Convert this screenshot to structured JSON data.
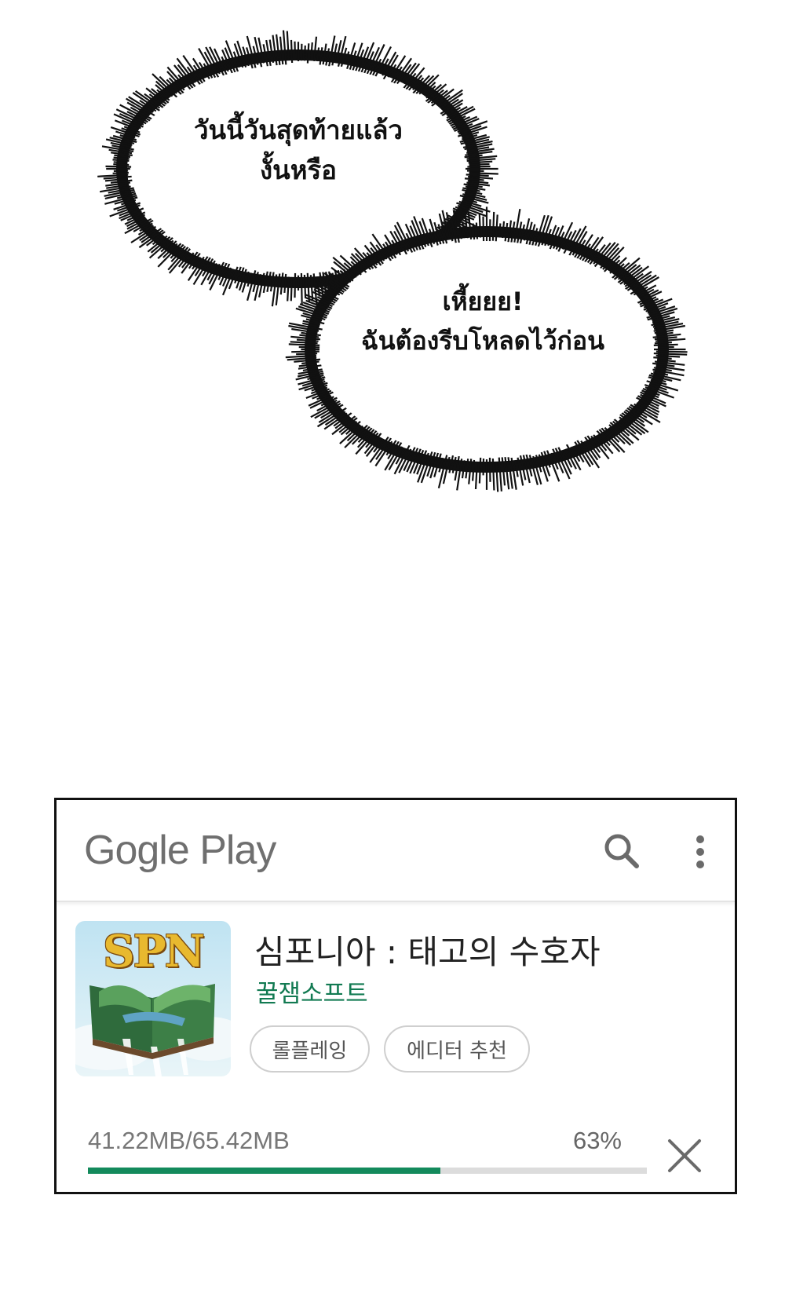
{
  "comic": {
    "bubble_1": {
      "line_1": "วันนี้วันสุดท้ายแล้ว",
      "line_2": "งั้นหรือ"
    },
    "bubble_2": {
      "line_1": "เหี้ยยย!",
      "line_2": "ฉันต้องรีบโหลดไว้ก่อน"
    }
  },
  "store": {
    "logo_text": "Gogle Play",
    "search_icon": "search-icon",
    "more_icon": "more-vert-icon",
    "app": {
      "icon_text": "SPN",
      "title": "심포니아 : 태고의 수호자",
      "developer": "꿀잼소프트",
      "tags": [
        "롤플레잉",
        "에디터 추천"
      ]
    },
    "download": {
      "size_text": "41.22MB/65.42MB",
      "percent_text": "63%",
      "progress": 0.63,
      "cancel_icon": "close-icon"
    },
    "colors": {
      "accent": "#138a5c",
      "developer": "#127a52",
      "track": "#dcdcdc"
    }
  }
}
